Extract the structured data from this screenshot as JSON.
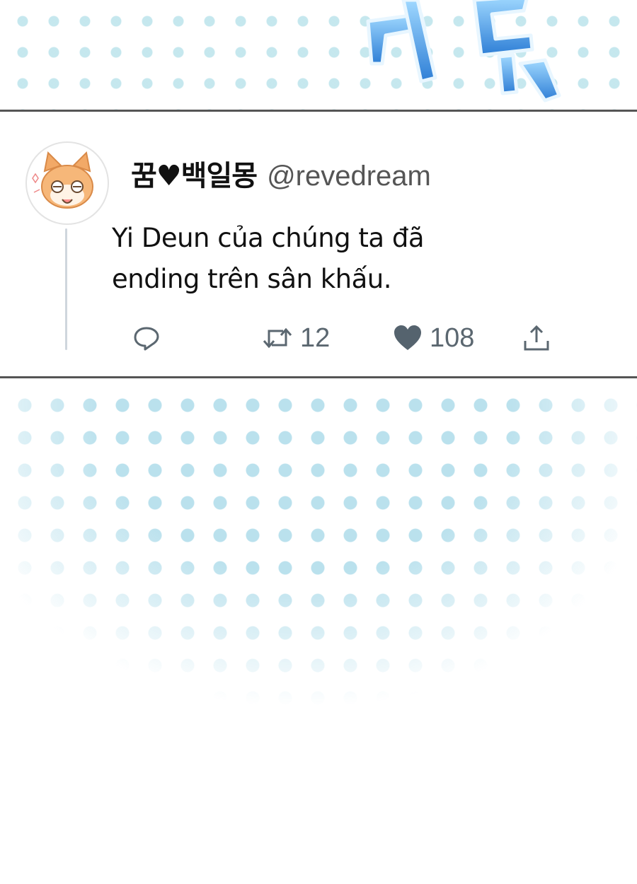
{
  "tweet": {
    "display_name": "꿈♥백일몽",
    "handle": "@revedream",
    "text_line1": "Yi Deun của chúng ta đã",
    "text_line2": "ending trên sân khấu.",
    "retweet_count": "12",
    "like_count": "108"
  },
  "icons": {
    "reply": "reply-icon",
    "retweet": "retweet-icon",
    "like": "heart-icon",
    "share": "share-icon",
    "avatar": "cat-avatar-icon"
  },
  "colors": {
    "dot": "#96d4e1",
    "sfx_blue": "#3d8fe0",
    "icon_gray": "#5b6770",
    "border": "#555555"
  }
}
